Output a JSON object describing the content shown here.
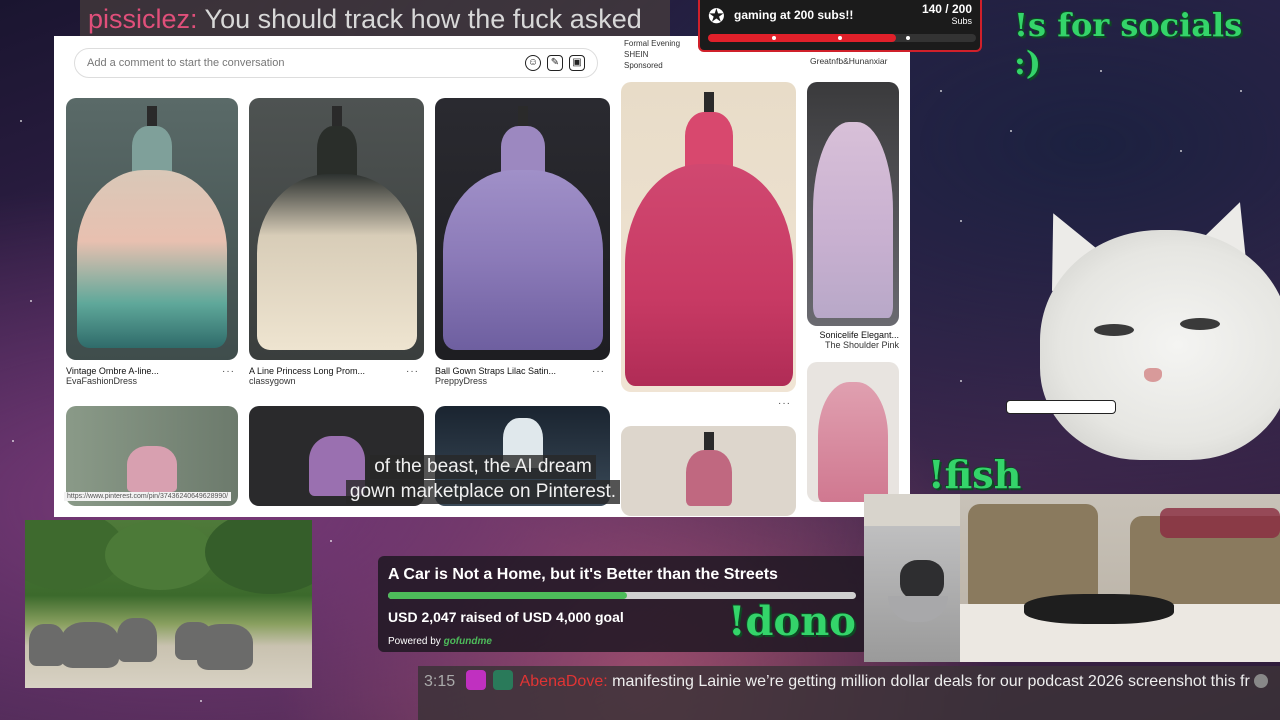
{
  "top_chat": {
    "username": "pissiclez:",
    "message": " You should track how the fuck asked"
  },
  "browser": {
    "comment_placeholder": "Add a comment to start the conversation",
    "comment_icons": [
      "emoji-icon",
      "sticker-icon",
      "image-icon"
    ],
    "sponsor_left": {
      "line1": "Formal Evening",
      "line2": "SHEIN",
      "line3": "Sponsored"
    },
    "sponsor_right": "Greatnfb&Hunanxiar",
    "pins": [
      {
        "title": "Vintage Ombre A-line...",
        "source": "EvaFashionDress"
      },
      {
        "title": "A Line Princess Long Prom...",
        "source": "classygown"
      },
      {
        "title": "Ball Gown Straps Lilac Satin...",
        "source": "PreppyDress"
      },
      {
        "title": "Sonicelife Elegant...",
        "source": "The Shoulder Pink"
      }
    ],
    "status_url": "https://www.pinterest.com/pin/37436240649628990/",
    "more_dots": "···"
  },
  "subtitles": {
    "line1": "of the beast, the AI dream",
    "line2": "gown marketplace on Pinterest."
  },
  "sub_goal": {
    "title": "gaming at 200 subs!!",
    "count": "140 / 200",
    "unit": "Subs",
    "progress": 0.7
  },
  "commands": {
    "socials": "!s for socials :)",
    "fish": "!fish",
    "dono": "!dono"
  },
  "donation": {
    "title": "A Car is Not a Home, but it's Better than the Streets",
    "raised": "USD 2,047 raised of USD 4,000 goal",
    "powered_by": "Powered by",
    "brand": "gofundme",
    "progress": 0.51
  },
  "bottom_chat": {
    "time": "3:15",
    "username": "AbenaDove:",
    "message": " manifesting Lainie we’re getting million dollar deals for our podcast 2026 screenshot this fr"
  },
  "colors": {
    "accent_red": "#d0202a",
    "dono_green": "#4dbb5a",
    "neon_green": "#34d46a"
  }
}
